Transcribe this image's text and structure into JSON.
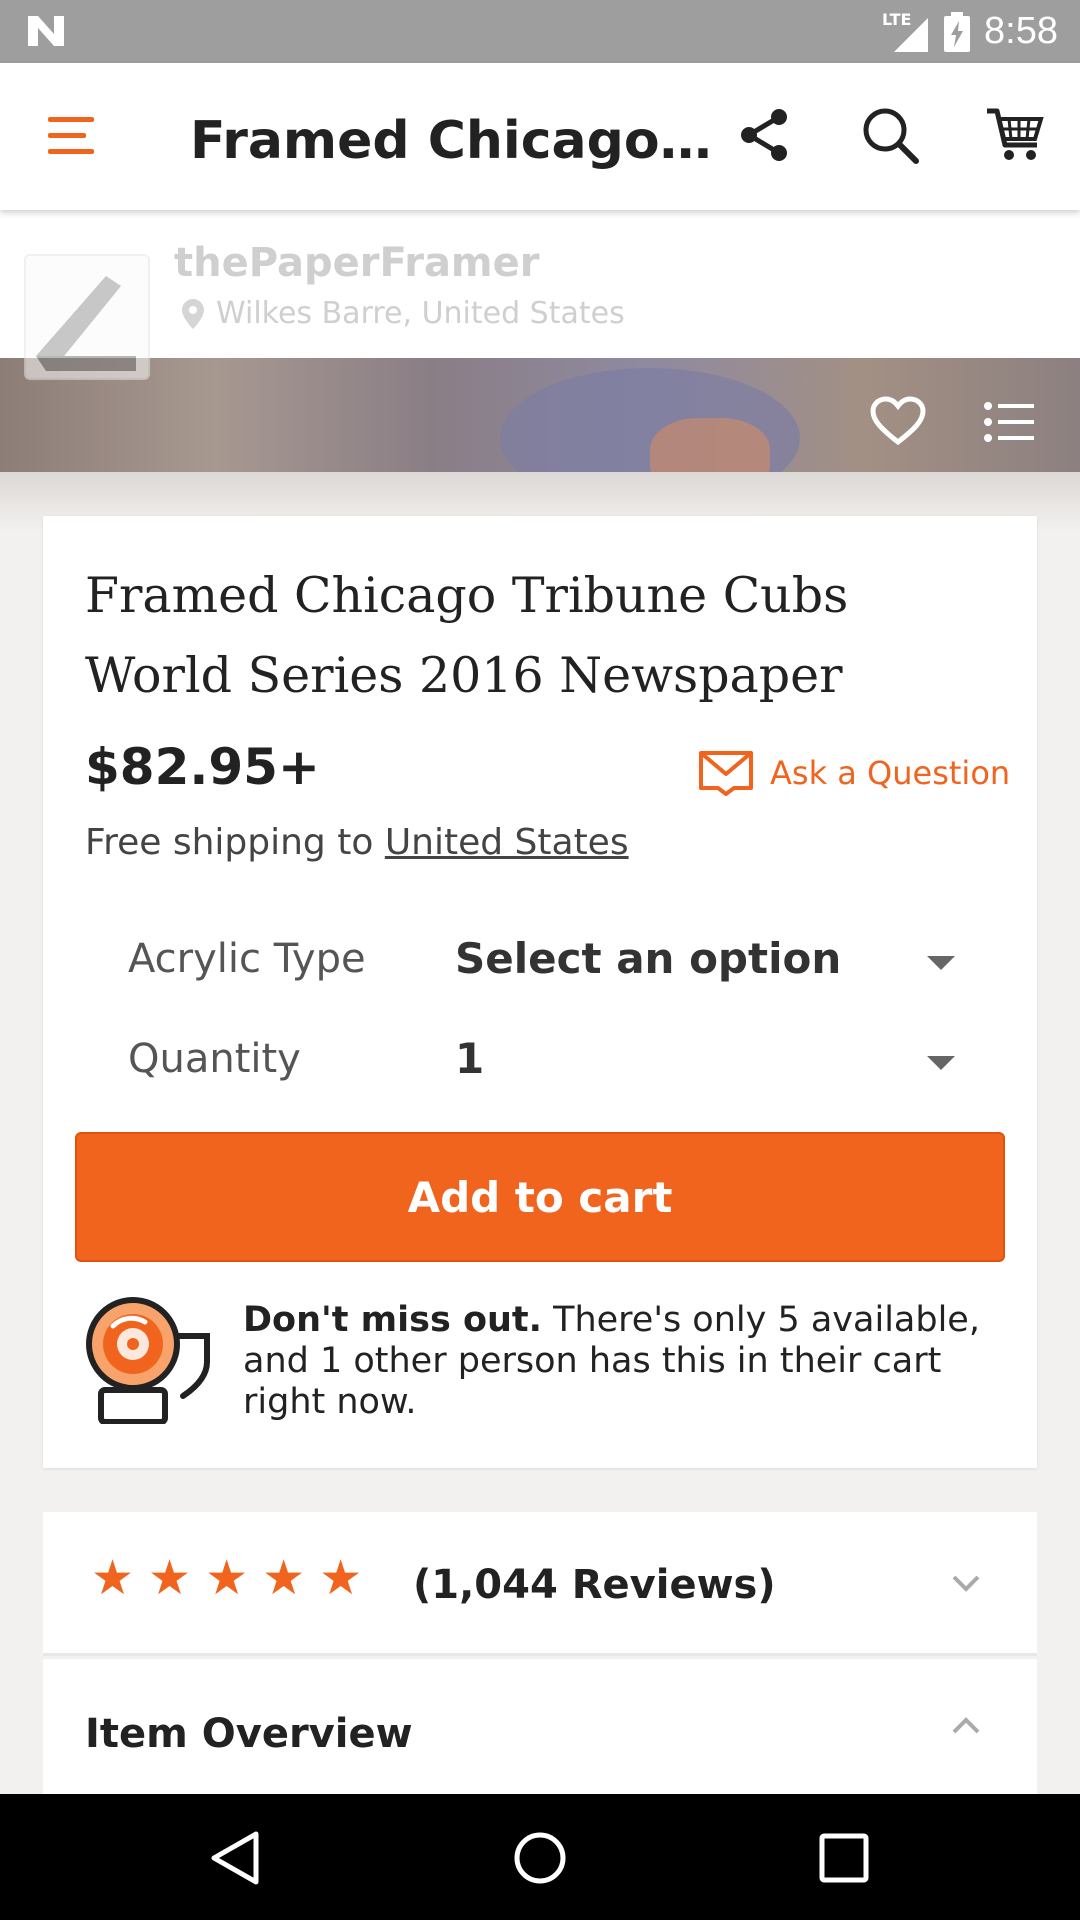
{
  "status_bar": {
    "network": "LTE",
    "time": "8:58"
  },
  "app_bar": {
    "title": "Framed Chicago…"
  },
  "shop": {
    "name": "thePaperFramer",
    "location": "Wilkes Barre, United States"
  },
  "product": {
    "title": "Framed Chicago Tribune Cubs World Series 2016  Newspaper",
    "price": "$82.95+",
    "ask_label": "Ask a Question",
    "shipping_prefix": "Free shipping to ",
    "shipping_link": "United States"
  },
  "options": [
    {
      "label": "Acrylic Type",
      "value": "Select an option"
    },
    {
      "label": "Quantity",
      "value": "1"
    }
  ],
  "cart_button": "Add to cart",
  "scarcity": {
    "bold": "Don't miss out.",
    "text": " There's only 5 available, and 1 other person has this in their cart right now."
  },
  "reviews": {
    "rating": 5,
    "stars": [
      "★",
      "★",
      "★",
      "★",
      "★"
    ],
    "count_label": "(1,044 Reviews)"
  },
  "overview": {
    "title": "Item Overview"
  },
  "colors": {
    "accent": "#f1641e",
    "status_bar": "#9e9e9e"
  }
}
